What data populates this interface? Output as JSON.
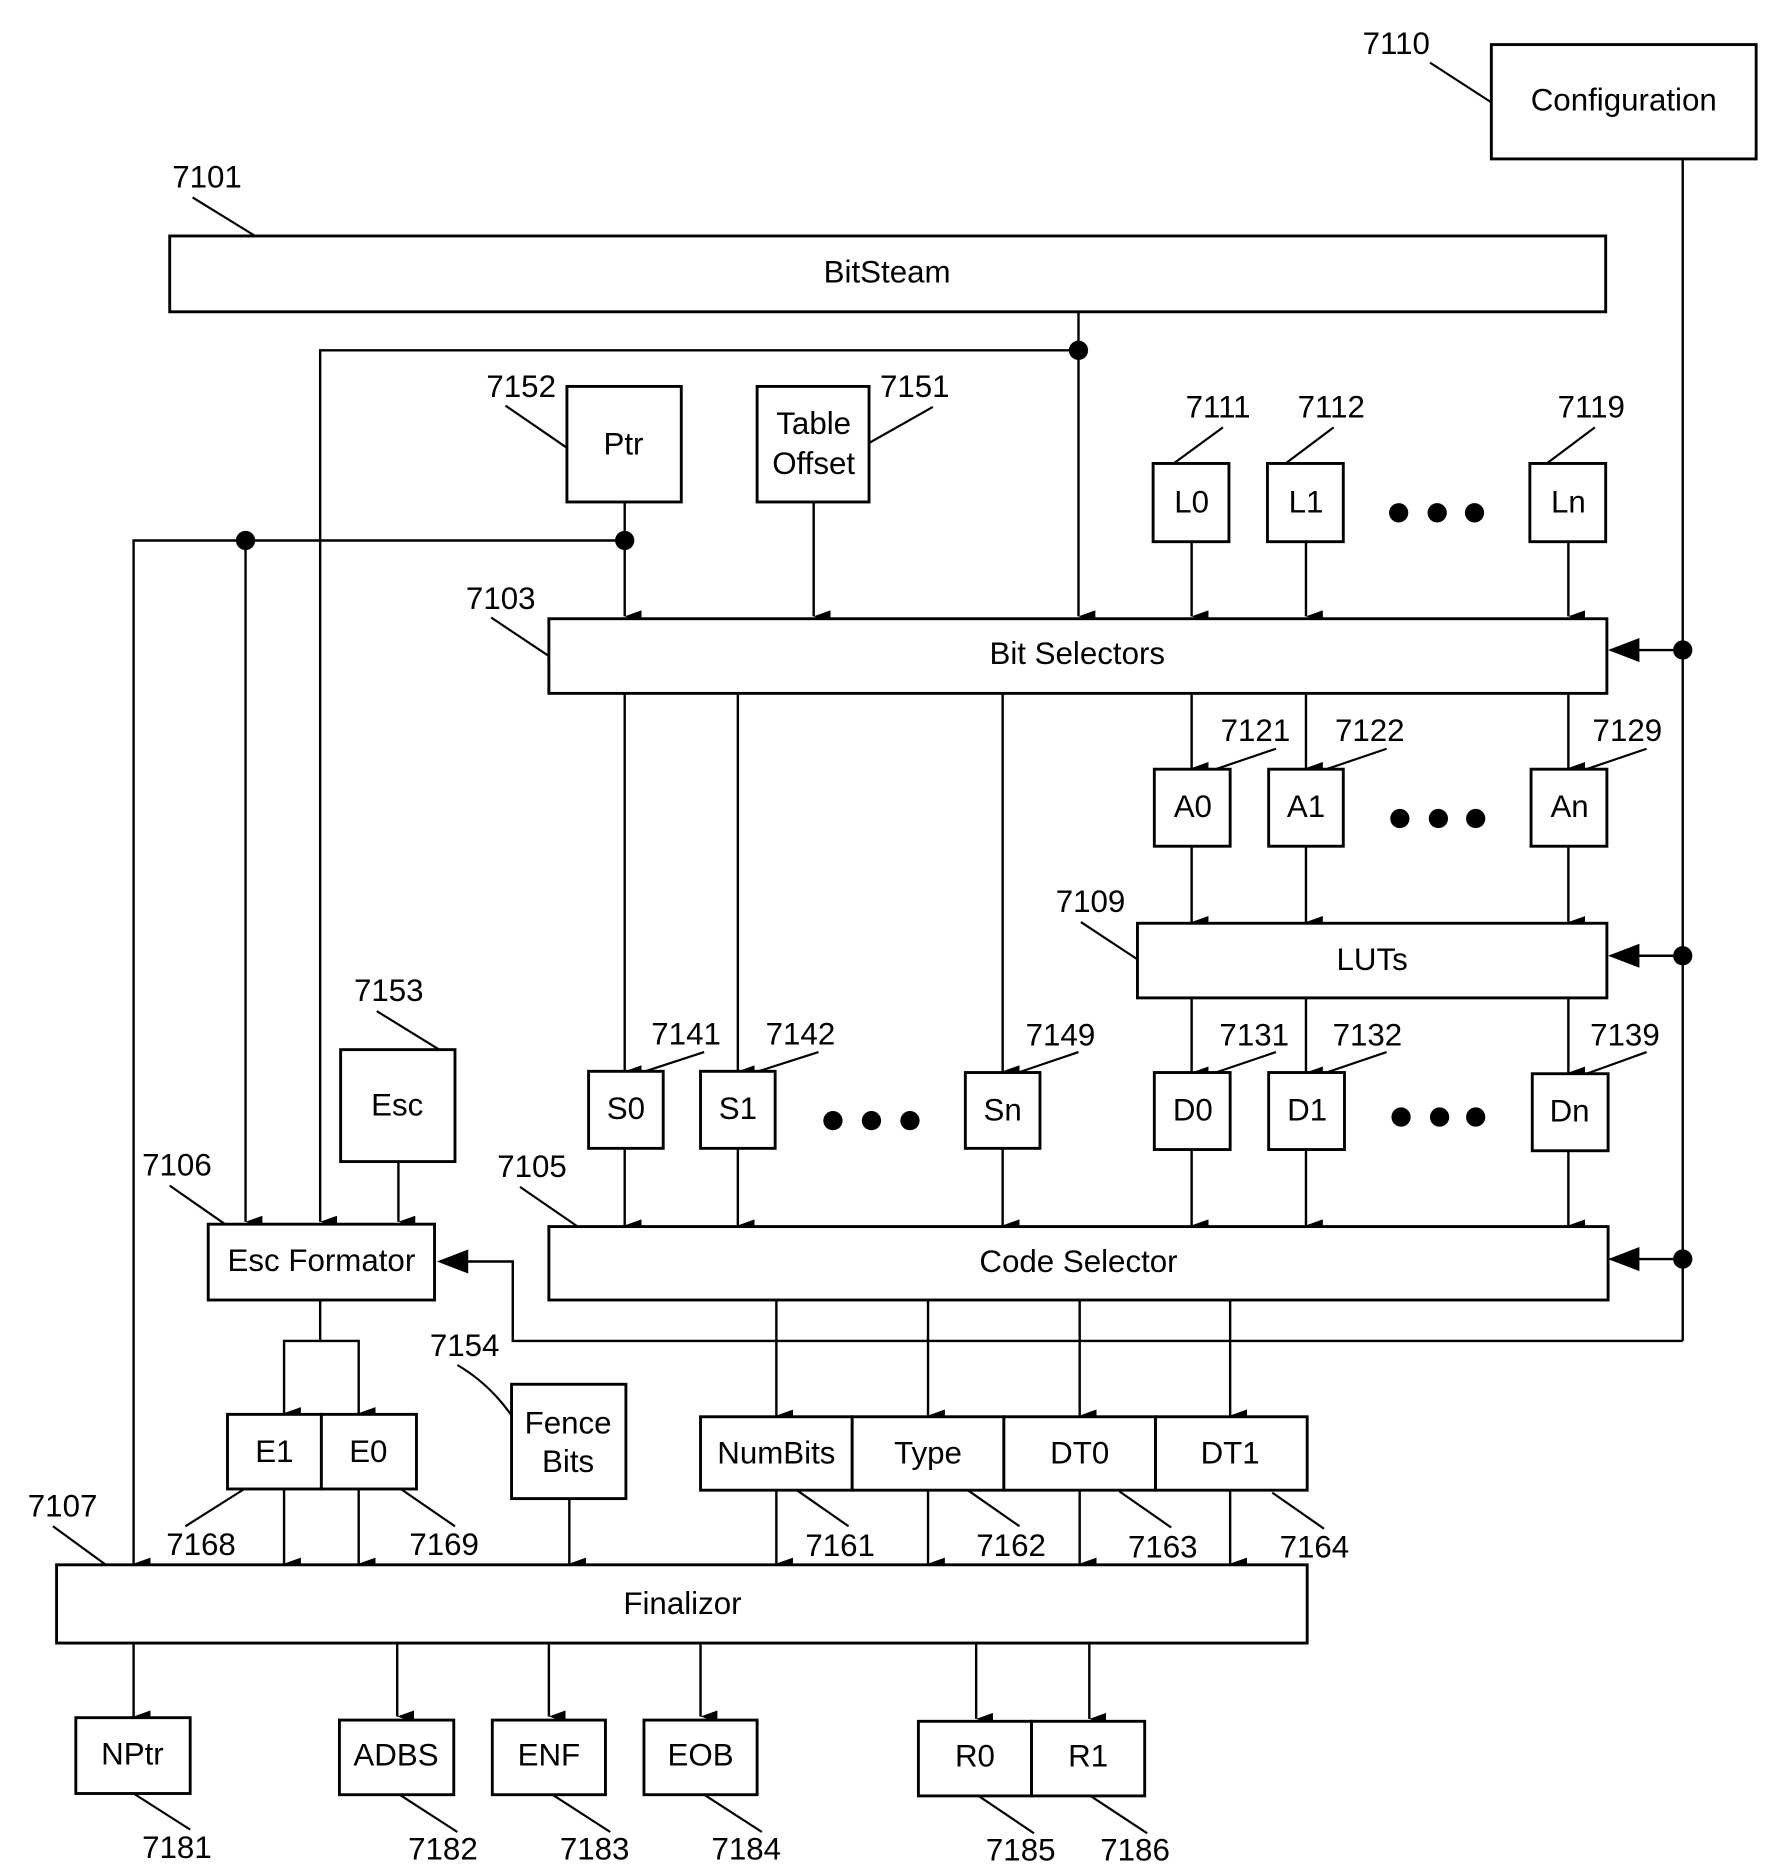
{
  "figure": {
    "blocks": {
      "configuration": {
        "label": "Configuration",
        "ref": "7110"
      },
      "bitstream": {
        "label": "BitSteam",
        "ref": "7101"
      },
      "ptr": {
        "label": "Ptr",
        "ref": "7152"
      },
      "table_offset": {
        "label_line1": "Table",
        "label_line2": "Offset",
        "ref": "7151"
      },
      "bit_selectors": {
        "label": "Bit Selectors",
        "ref": "7103"
      },
      "luts": {
        "label": "LUTs",
        "ref": "7109"
      },
      "esc": {
        "label": "Esc",
        "ref": "7153"
      },
      "esc_formator": {
        "label": "Esc Formator",
        "ref": "7106"
      },
      "code_selector": {
        "label": "Code Selector",
        "ref": "7105"
      },
      "fence_bits": {
        "label_line1": "Fence",
        "label_line2": "Bits",
        "ref": "7154"
      },
      "finalizor": {
        "label": "Finalizor",
        "ref": "7107"
      }
    },
    "l_regs": [
      {
        "label": "L0",
        "ref": "7111"
      },
      {
        "label": "L1",
        "ref": "7112"
      },
      {
        "label": "Ln",
        "ref": "7119"
      }
    ],
    "a_regs": [
      {
        "label": "A0",
        "ref": "7121"
      },
      {
        "label": "A1",
        "ref": "7122"
      },
      {
        "label": "An",
        "ref": "7129"
      }
    ],
    "d_regs": [
      {
        "label": "D0",
        "ref": "7131"
      },
      {
        "label": "D1",
        "ref": "7132"
      },
      {
        "label": "Dn",
        "ref": "7139"
      }
    ],
    "s_regs": [
      {
        "label": "S0",
        "ref": "7141"
      },
      {
        "label": "S1",
        "ref": "7142"
      },
      {
        "label": "Sn",
        "ref": "7149"
      }
    ],
    "e_regs": [
      {
        "label": "E1",
        "ref": "7168"
      },
      {
        "label": "E0",
        "ref": "7169"
      }
    ],
    "code_fields": [
      {
        "label": "NumBits",
        "ref": "7161"
      },
      {
        "label": "Type",
        "ref": "7162"
      },
      {
        "label": "DT0",
        "ref": "7163"
      },
      {
        "label": "DT1",
        "ref": "7164"
      }
    ],
    "outputs": [
      {
        "label": "NPtr",
        "ref": "7181"
      },
      {
        "label": "ADBS",
        "ref": "7182"
      },
      {
        "label": "ENF",
        "ref": "7183"
      },
      {
        "label": "EOB",
        "ref": "7184"
      },
      {
        "label": "R0",
        "ref": "7185"
      },
      {
        "label": "R1",
        "ref": "7186"
      }
    ]
  }
}
